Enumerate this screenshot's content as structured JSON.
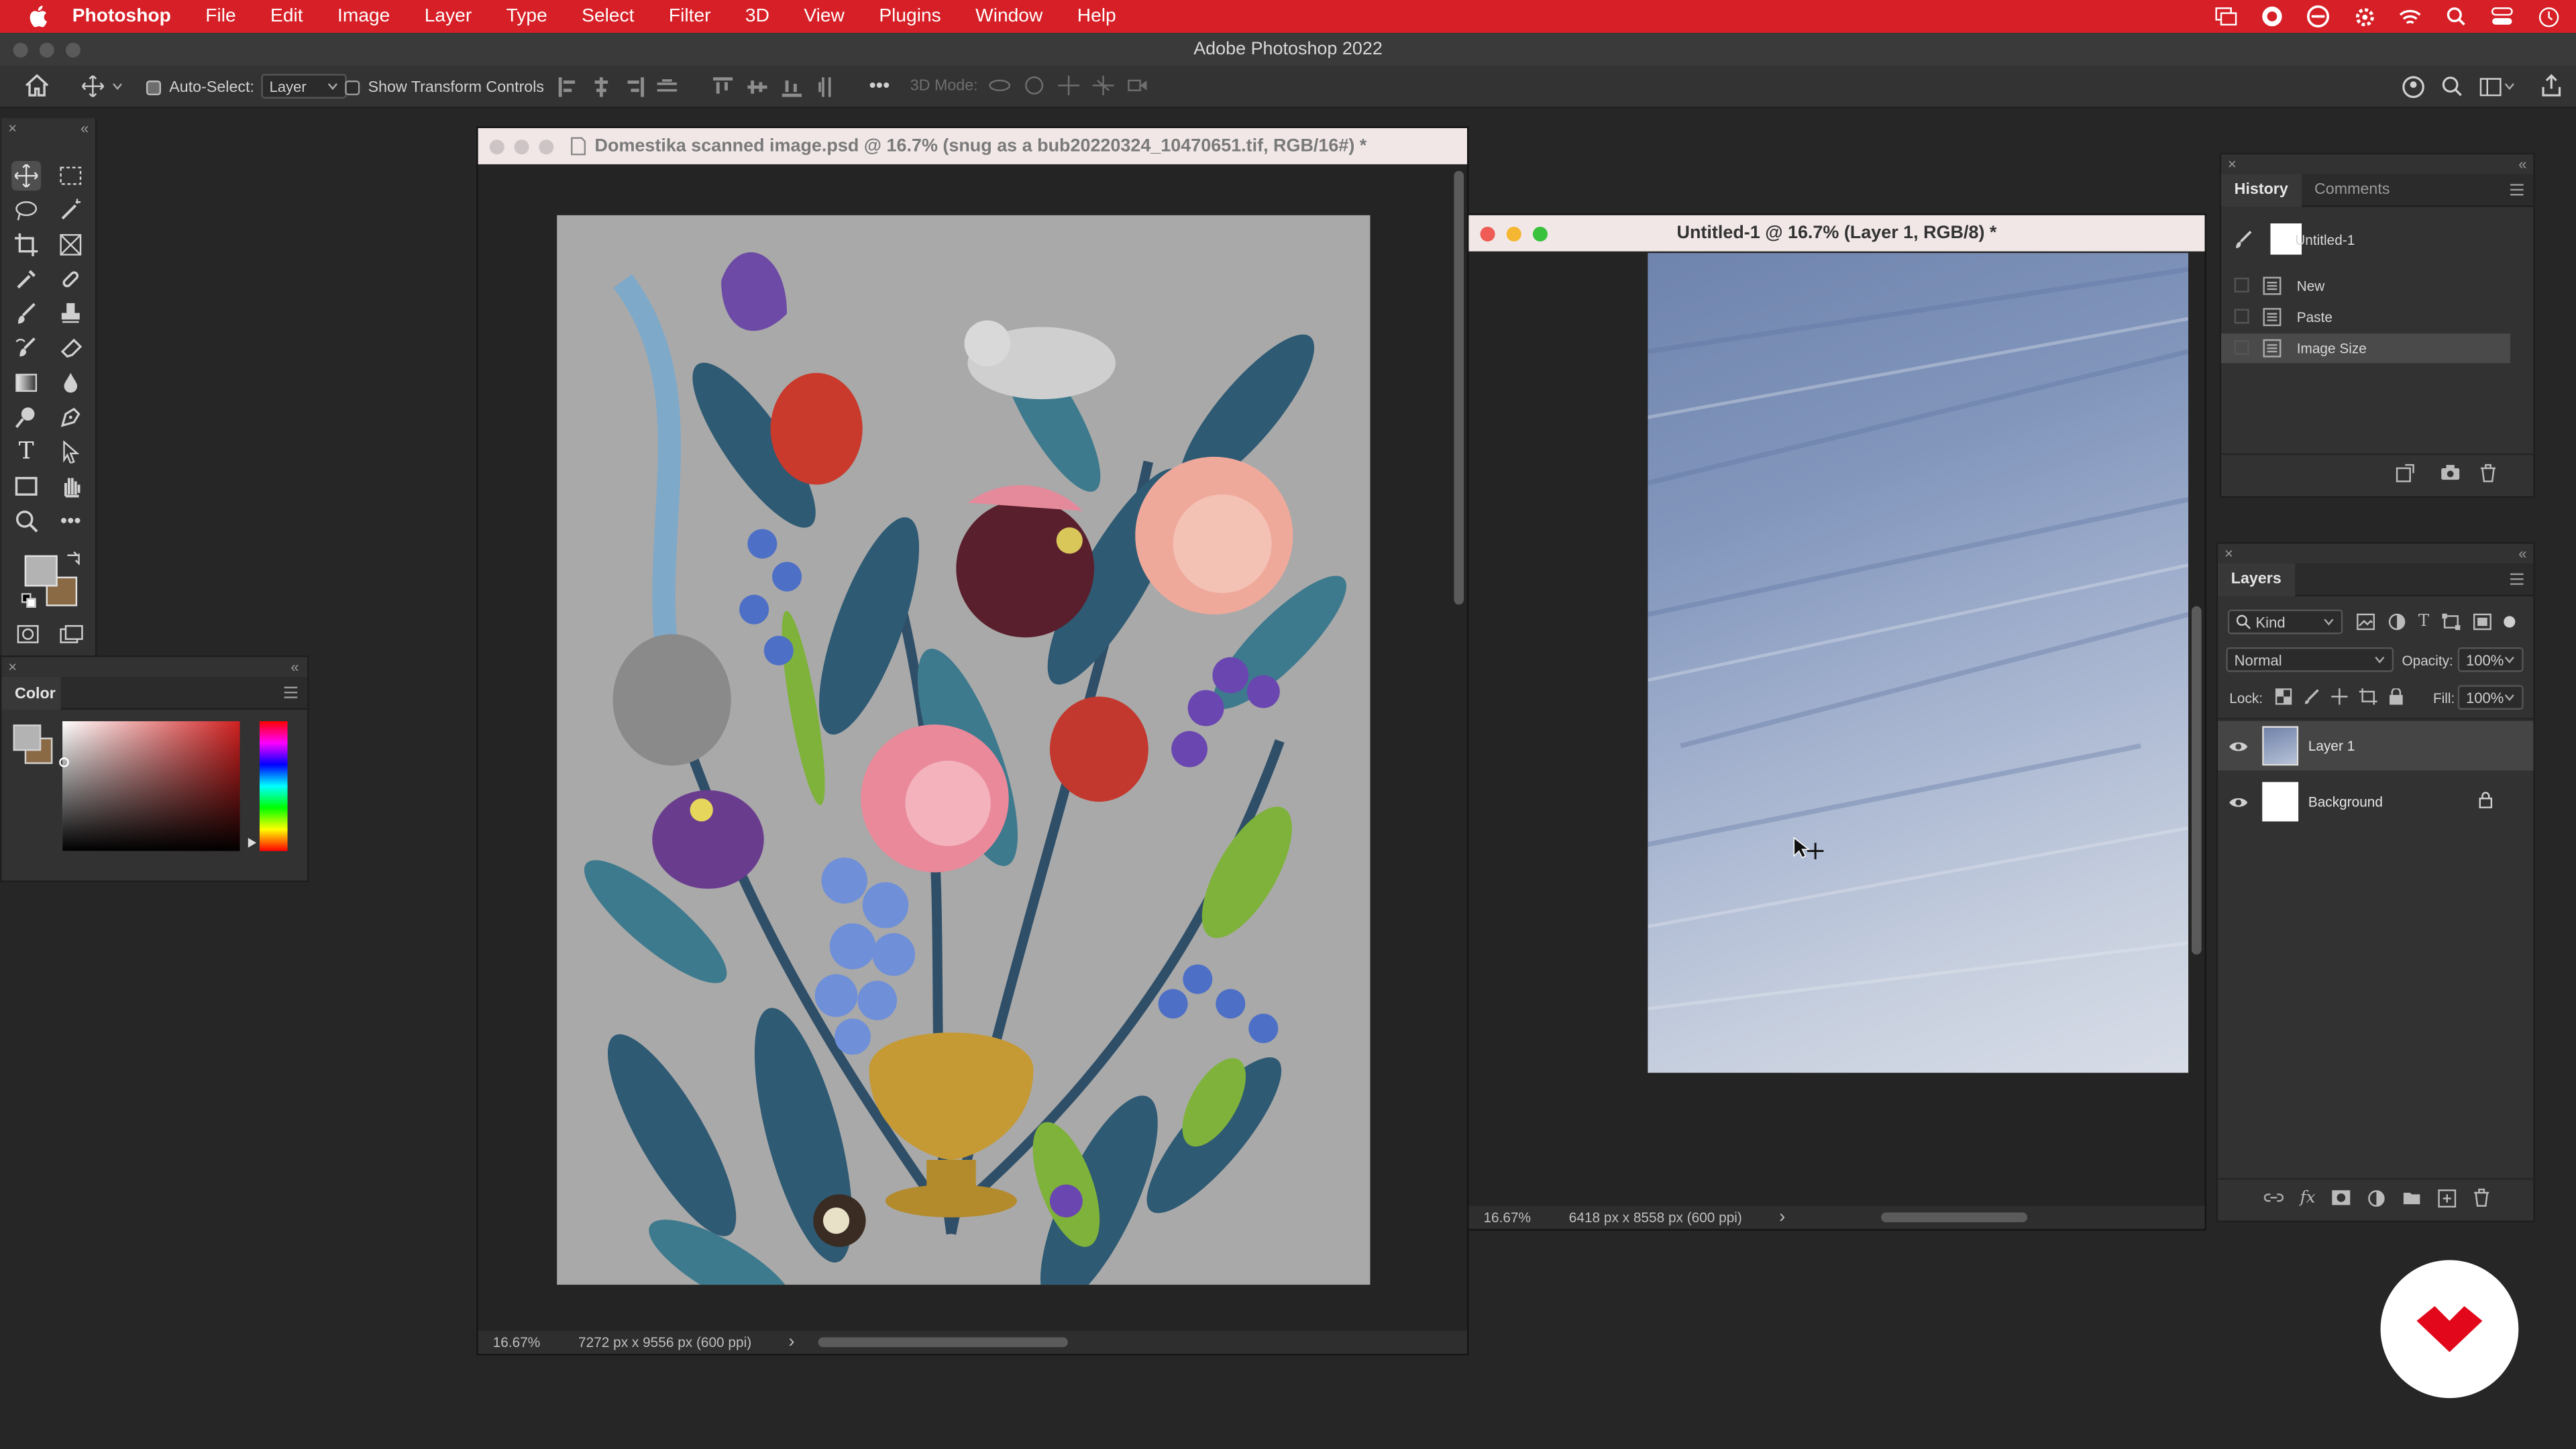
{
  "menubar": {
    "app": "Photoshop",
    "items": [
      "File",
      "Edit",
      "Image",
      "Layer",
      "Type",
      "Select",
      "Filter",
      "3D",
      "View",
      "Plugins",
      "Window",
      "Help"
    ]
  },
  "app_title": "Adobe Photoshop 2022",
  "options": {
    "auto_select_label": "Auto-Select:",
    "auto_select_value": "Layer",
    "show_transform_label": "Show Transform Controls",
    "mode_3d_label": "3D Mode:"
  },
  "color_panel": {
    "title": "Color"
  },
  "doc1": {
    "title": "Domestika scanned image.psd @ 16.7% (snug as a bub20220324_10470651.tif, RGB/16#) *",
    "zoom": "16.67%",
    "dims": "7272 px x 9556 px (600 ppi)",
    "arrow": "›"
  },
  "doc2": {
    "title": "Untitled-1 @ 16.7% (Layer 1, RGB/8) *",
    "zoom": "16.67%",
    "dims": "6418 px x 8558 px (600 ppi)",
    "arrow": "›"
  },
  "history": {
    "tabs": [
      "History",
      "Comments"
    ],
    "snapshot": "Untitled-1",
    "items": [
      "New",
      "Paste",
      "Image Size"
    ]
  },
  "layers": {
    "title": "Layers",
    "kind": "Kind",
    "blend": "Normal",
    "opacity_label": "Opacity:",
    "opacity": "100%",
    "lock_label": "Lock:",
    "fill_label": "Fill:",
    "fill": "100%",
    "rows": [
      "Layer 1",
      "Background"
    ]
  },
  "colors": {
    "menubar": "#d61f26",
    "foreground": "#b3b3b3",
    "background_swatch": "#8a6a45",
    "brand": "#e3071b"
  }
}
